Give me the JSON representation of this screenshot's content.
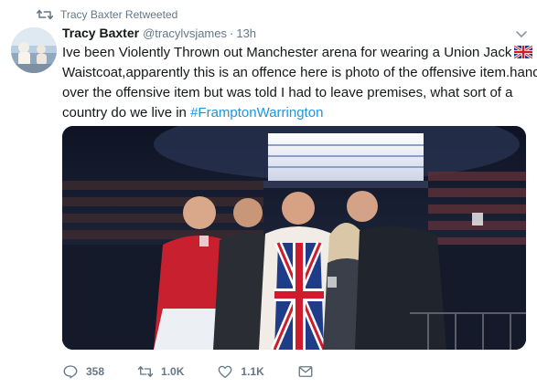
{
  "retweet_context": {
    "label": "Tracy Baxter Retweeted"
  },
  "tweet": {
    "author_name": "Tracy Baxter",
    "author_handle": "@tracylvsjames",
    "separator": "·",
    "timestamp": "13h",
    "text_lines": [
      "Ive been Violently Thrown out Manchester arena for wearing a Union Jack",
      "Waistcoat,apparently this is an offence here is photo of the offensive item.handed",
      "over the offensive item but was told I had to leave premises, what sort of a",
      "country do we live in "
    ],
    "hashtag": "#FramptonWarrington",
    "flag_emoji": "union-jack-flag"
  },
  "actions": {
    "reply_count": "358",
    "retweet_count": "1.0K",
    "like_count": "1.1K"
  },
  "icons": {
    "retweet": "retweet-icon",
    "reply": "reply-icon",
    "like": "heart-icon",
    "dm": "envelope-icon",
    "caret": "chevron-down-icon"
  },
  "colors": {
    "link": "#1b95e0",
    "secondary_text": "#657786",
    "primary_text": "#14171a"
  }
}
